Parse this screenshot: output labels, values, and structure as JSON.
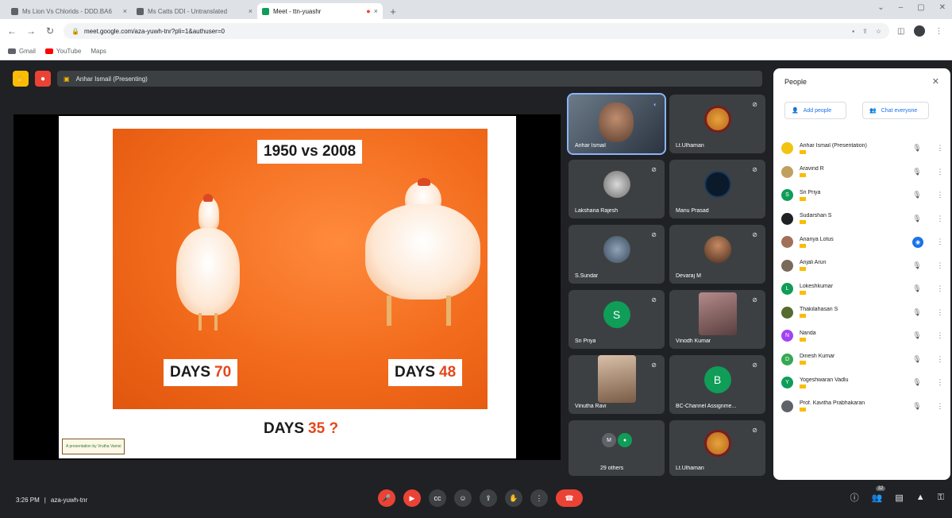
{
  "browser": {
    "tabs": [
      {
        "label": "Ms Lion Vs Chlorids - DDD.BA6"
      },
      {
        "label": "Ms Catts DDI - Untranslated"
      },
      {
        "label": "Meet - ttn-yuashr"
      }
    ],
    "url": "meet.google.com/aza-yuwh-tnr?pli=1&authuser=0",
    "bookmarks": [
      {
        "label": "Gmail",
        "icon": "gmail-icon"
      },
      {
        "label": "YouTube",
        "icon": "youtube-icon"
      },
      {
        "label": "Maps",
        "icon": "maps-icon"
      }
    ]
  },
  "meet": {
    "presenting_label": "Anhar Ismail (Presenting)",
    "slide": {
      "title": "1950 vs 2008",
      "days_word": "DAYS",
      "days_left": "70",
      "days_right": "48",
      "days_bottom": "35 ?",
      "credit": "A presentation by Vrutha Vamsi"
    },
    "tiles": [
      {
        "name": "Anhar Ismail",
        "kind": "video"
      },
      {
        "name": "Lt.Ulhaman",
        "kind": "logo"
      },
      {
        "name": "Lakshana Rajesh",
        "kind": "image"
      },
      {
        "name": "Manu Prasad",
        "kind": "circle"
      },
      {
        "name": "S.Sundar",
        "kind": "image"
      },
      {
        "name": "Devaraj M",
        "kind": "image"
      },
      {
        "name": "Sri Priya",
        "kind": "letter",
        "letter": "S",
        "color": "#0f9d58"
      },
      {
        "name": "Vinodh Kumar",
        "kind": "image"
      },
      {
        "name": "Vinutha Ravi",
        "kind": "image"
      },
      {
        "name": "BC-Channel Assignme...",
        "kind": "letter",
        "letter": "B",
        "color": "#0f9d58"
      },
      {
        "name": "29 others",
        "kind": "group"
      },
      {
        "name": "Lt.Ulhaman",
        "kind": "logo"
      }
    ],
    "people": {
      "title": "People",
      "add_label": "Add people",
      "chat_label": "Chat everyone",
      "list": [
        {
          "name": "Anhar Ismail (Presentation)",
          "color": "#f1c40f"
        },
        {
          "name": "Aravind R",
          "color": "#c0a060"
        },
        {
          "name": "Sri Priya",
          "color": "#0f9d58",
          "letter": "S"
        },
        {
          "name": "Sudarshan S",
          "color": "#202124"
        },
        {
          "name": "Ananya Lotus",
          "color": "#a0705a",
          "mic": "active"
        },
        {
          "name": "Anjali Arun",
          "color": "#7a6a5a"
        },
        {
          "name": "Lokeshkumar",
          "color": "#0f9d58",
          "letter": "L"
        },
        {
          "name": "Thakilahasan S",
          "color": "#556b2f"
        },
        {
          "name": "Nanda",
          "color": "#a142f4",
          "letter": "N"
        },
        {
          "name": "Dinesh Kumar",
          "color": "#34a853",
          "letter": "D"
        },
        {
          "name": "Yogeshwaran Vadlu",
          "color": "#0f9d58",
          "letter": "Y"
        },
        {
          "name": "Prof. Kavitha Prabhakaran",
          "color": "#5f6368"
        }
      ]
    },
    "bottom": {
      "time": "3:26 PM",
      "code": "aza-yuwh-tnr",
      "participant_count": "32"
    }
  }
}
